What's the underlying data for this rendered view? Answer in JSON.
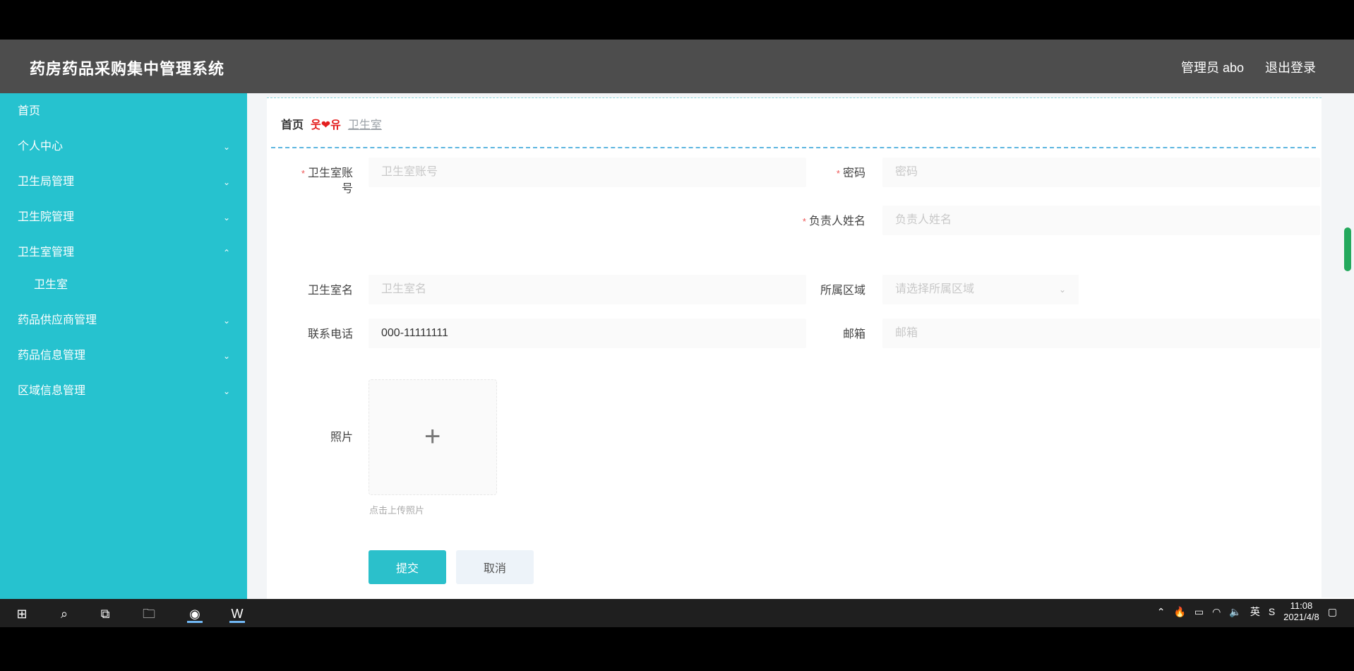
{
  "app_title": "药房药品采购集中管理系统",
  "header": {
    "user_label": "管理员 abo",
    "logout": "退出登录"
  },
  "sidebar": {
    "items": [
      {
        "label": "首页",
        "chevron": ""
      },
      {
        "label": "个人中心",
        "chevron": "⌄"
      },
      {
        "label": "卫生局管理",
        "chevron": "⌄"
      },
      {
        "label": "卫生院管理",
        "chevron": "⌄"
      },
      {
        "label": "卫生室管理",
        "chevron": "⌃"
      },
      {
        "label": "卫生室",
        "chevron": ""
      },
      {
        "label": "药品供应商管理",
        "chevron": "⌄"
      },
      {
        "label": "药品信息管理",
        "chevron": "⌄"
      },
      {
        "label": "区域信息管理",
        "chevron": "⌄"
      }
    ]
  },
  "breadcrumb": {
    "home": "首页",
    "separator": "웃❤유",
    "current": "卫生室"
  },
  "form": {
    "account": {
      "label": "卫生室账号",
      "placeholder": "卫生室账号",
      "value": ""
    },
    "password": {
      "label": "密码",
      "placeholder": "密码",
      "value": ""
    },
    "responsible_name": {
      "label": "负责人姓名",
      "placeholder": "负责人姓名",
      "value": ""
    },
    "clinic_name": {
      "label": "卫生室名",
      "placeholder": "卫生室名",
      "value": ""
    },
    "region": {
      "label": "所属区域",
      "placeholder": "请选择所属区域",
      "value": ""
    },
    "phone": {
      "label": "联系电话",
      "placeholder": "",
      "value": "000-11111111"
    },
    "email": {
      "label": "邮箱",
      "placeholder": "邮箱",
      "value": ""
    },
    "photo": {
      "label": "照片",
      "hint": "点击上传照片"
    },
    "submit": "提交",
    "cancel": "取消"
  },
  "ime": {
    "lang": "英"
  },
  "taskbar": {
    "time": "11:08",
    "date": "2021/4/8",
    "input_lang": "英"
  }
}
